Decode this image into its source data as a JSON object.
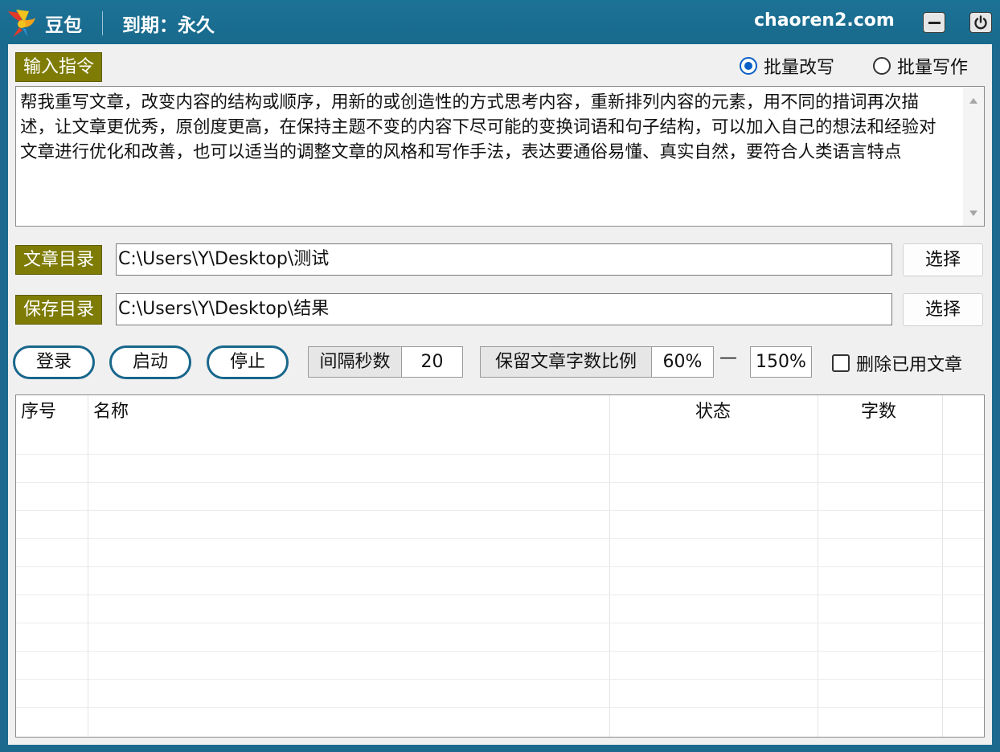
{
  "titlebar": {
    "app_name": "豆包",
    "expiry": "到期：永久",
    "site": "chaoren2.com"
  },
  "instruction": {
    "label": "输入指令",
    "modes": [
      {
        "label": "批量改写",
        "selected": true
      },
      {
        "label": "批量写作",
        "selected": false
      }
    ],
    "prompt": "帮我重写文章，改变内容的结构或顺序，用新的或创造性的方式思考内容，重新排列内容的元素，用不同的措词再次描述，让文章更优秀，原创度更高，在保持主题不变的内容下尽可能的变换词语和句子结构，可以加入自己的想法和经验对文章进行优化和改善，也可以适当的调整文章的风格和写作手法，表达要通俗易懂、真实自然，要符合人类语言特点"
  },
  "article_dir": {
    "label": "文章目录",
    "value": "C:\\Users\\Y\\Desktop\\测试",
    "button": "选择"
  },
  "save_dir": {
    "label": "保存目录",
    "value": "C:\\Users\\Y\\Desktop\\结果",
    "button": "选择"
  },
  "controls": {
    "login": "登录",
    "start": "启动",
    "stop": "停止",
    "interval_label": "间隔秒数",
    "interval_value": "20",
    "ratio_label": "保留文章字数比例",
    "ratio_min": "60%",
    "ratio_sep": "—",
    "ratio_max": "150%",
    "delete_used_label": "删除已用文章",
    "delete_used_checked": false
  },
  "table": {
    "columns": [
      "序号",
      "名称",
      "状态",
      "字数"
    ],
    "rows": []
  },
  "colors": {
    "titlebar": "#1b6a8e",
    "label_bg": "#7f7c06",
    "radio_accent": "#0a5fc6",
    "pill_border": "#19678c"
  }
}
